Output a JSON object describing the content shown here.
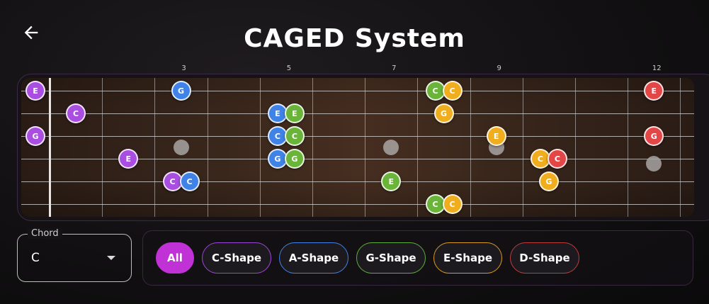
{
  "header": {
    "title": "CAGED System",
    "back_icon": "arrow-left-icon"
  },
  "fretboard": {
    "fret_markers": [
      "3",
      "5",
      "7",
      "9",
      "12"
    ],
    "string_count": 6,
    "visible_frets": 12,
    "inlay_frets": [
      3,
      7,
      9,
      12
    ],
    "notes": [
      {
        "string": 1,
        "fret": 0,
        "label": "E",
        "color": "#a94ee0"
      },
      {
        "string": 1,
        "fret": 3,
        "label": "G",
        "color": "#3f83e8"
      },
      {
        "string": 1,
        "fret": 8,
        "label": "C",
        "color": "#6ab43a"
      },
      {
        "string": 1,
        "fret": 8,
        "label": "C",
        "color": "#f0ad1e"
      },
      {
        "string": 1,
        "fret": 12,
        "label": "E",
        "color": "#e24646"
      },
      {
        "string": 2,
        "fret": 1,
        "label": "C",
        "color": "#a94ee0"
      },
      {
        "string": 2,
        "fret": 5,
        "label": "E",
        "color": "#3f83e8"
      },
      {
        "string": 2,
        "fret": 5,
        "label": "E",
        "color": "#6ab43a"
      },
      {
        "string": 2,
        "fret": 8,
        "label": "G",
        "color": "#f0ad1e"
      },
      {
        "string": 3,
        "fret": 0,
        "label": "G",
        "color": "#a94ee0"
      },
      {
        "string": 3,
        "fret": 5,
        "label": "C",
        "color": "#3f83e8"
      },
      {
        "string": 3,
        "fret": 5,
        "label": "C",
        "color": "#6ab43a"
      },
      {
        "string": 3,
        "fret": 9,
        "label": "E",
        "color": "#f0ad1e"
      },
      {
        "string": 3,
        "fret": 12,
        "label": "G",
        "color": "#e24646"
      },
      {
        "string": 4,
        "fret": 2,
        "label": "E",
        "color": "#a94ee0"
      },
      {
        "string": 4,
        "fret": 5,
        "label": "G",
        "color": "#3f83e8"
      },
      {
        "string": 4,
        "fret": 5,
        "label": "G",
        "color": "#6ab43a"
      },
      {
        "string": 4,
        "fret": 10,
        "label": "C",
        "color": "#f0ad1e"
      },
      {
        "string": 4,
        "fret": 10,
        "label": "C",
        "color": "#e24646"
      },
      {
        "string": 5,
        "fret": 3,
        "label": "C",
        "color": "#a94ee0"
      },
      {
        "string": 5,
        "fret": 3,
        "label": "C",
        "color": "#3f83e8"
      },
      {
        "string": 5,
        "fret": 7,
        "label": "E",
        "color": "#6ab43a"
      },
      {
        "string": 5,
        "fret": 10,
        "label": "G",
        "color": "#f0ad1e"
      },
      {
        "string": 6,
        "fret": 8,
        "label": "C",
        "color": "#6ab43a"
      },
      {
        "string": 6,
        "fret": 8,
        "label": "C",
        "color": "#f0ad1e"
      }
    ]
  },
  "chord_select": {
    "label": "Chord",
    "value": "C"
  },
  "shape_filter": {
    "chips": [
      {
        "label": "All",
        "color": "#c132d6",
        "selected": true
      },
      {
        "label": "C-Shape",
        "color": "#9b45d6",
        "selected": false
      },
      {
        "label": "A-Shape",
        "color": "#3f83e8",
        "selected": false
      },
      {
        "label": "G-Shape",
        "color": "#5fae3a",
        "selected": false
      },
      {
        "label": "E-Shape",
        "color": "#d99a1e",
        "selected": false
      },
      {
        "label": "D-Shape",
        "color": "#c13b3b",
        "selected": false
      }
    ]
  }
}
